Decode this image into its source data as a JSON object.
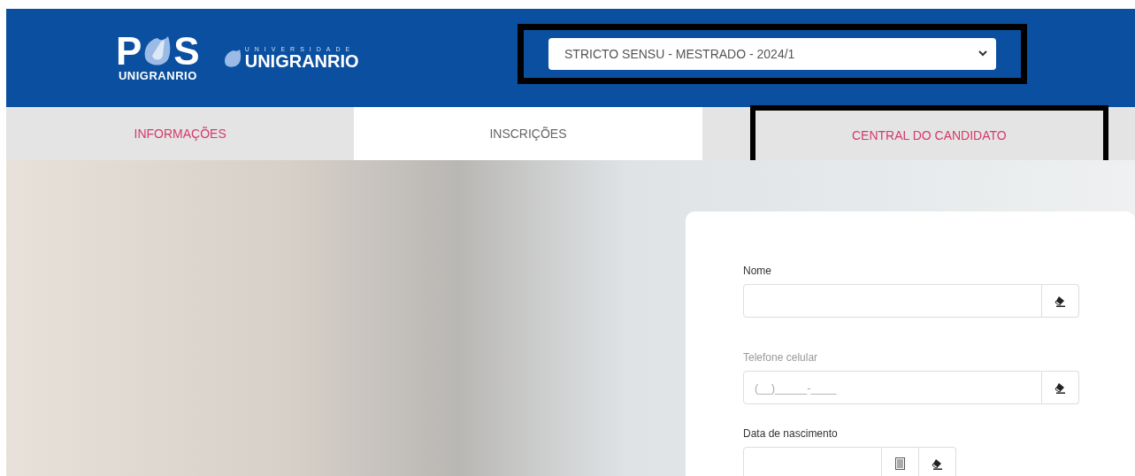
{
  "header": {
    "logo": {
      "left_letter": "P",
      "right_letter": "S",
      "subtitle": "UNIGRANRIO"
    },
    "university": {
      "overline": "UNIVERSIDADE",
      "name": "UNIGRANRIO"
    },
    "course_select": {
      "value": "STRICTO SENSU - MESTRADO - 2024/1",
      "highlighted": true
    }
  },
  "tabs": [
    {
      "label": "INFORMAÇÕES",
      "selected": false,
      "highlighted": false
    },
    {
      "label": "INSCRIÇÕES",
      "selected": true,
      "highlighted": false
    },
    {
      "label": "CENTRAL DO CANDIDATO",
      "selected": false,
      "highlighted": true
    }
  ],
  "form": {
    "fields": [
      {
        "label": "Nome",
        "kind": "text",
        "muted": false
      },
      {
        "label": "Telefone celular",
        "kind": "text",
        "muted": true,
        "placeholder": "(__)_____-____"
      },
      {
        "label": "Data de nascimento",
        "kind": "date",
        "muted": false
      }
    ]
  }
}
